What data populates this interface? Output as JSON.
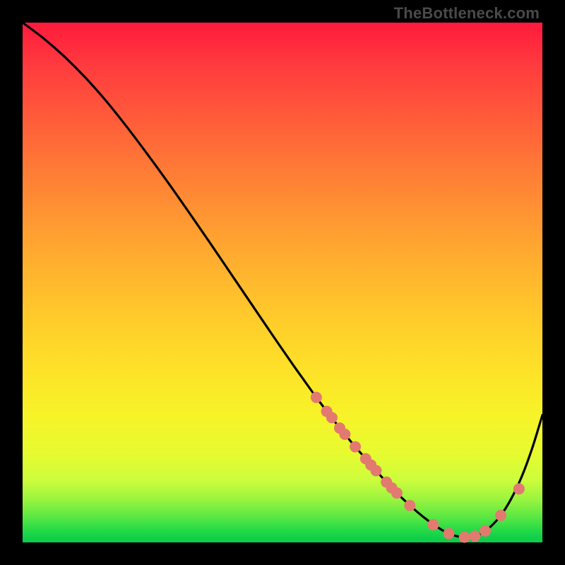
{
  "watermark": "TheBottleneck.com",
  "colors": {
    "background": "#000000",
    "gradient_top": "#ff1a3c",
    "gradient_bottom": "#0ccc4a",
    "curve": "#000000",
    "marker_fill": "#e27a70",
    "marker_stroke": "#c45a50"
  },
  "chart_data": {
    "type": "line",
    "title": "",
    "xlabel": "",
    "ylabel": "",
    "xlim": [
      0,
      100
    ],
    "ylim": [
      0,
      100
    ],
    "series": [
      {
        "name": "bottleneck-curve",
        "x": [
          0,
          4,
          8,
          12,
          16,
          20,
          24,
          28,
          32,
          36,
          40,
          44,
          48,
          52,
          54,
          56,
          58,
          60,
          62,
          64,
          66,
          68,
          70,
          72,
          74,
          76,
          78,
          80,
          82,
          84,
          86,
          88,
          90,
          92,
          94,
          96,
          98,
          100
        ],
        "y": [
          100,
          97,
          93.5,
          89.5,
          85,
          80,
          74.7,
          69.2,
          63.5,
          57.7,
          51.8,
          45.9,
          40,
          34.2,
          31.4,
          28.6,
          25.9,
          23.3,
          20.8,
          18.4,
          16.1,
          13.8,
          11.6,
          9.5,
          7.6,
          5.8,
          4.2,
          2.8,
          1.7,
          1.1,
          1.0,
          1.6,
          3.0,
          5.2,
          8.4,
          12.6,
          18.0,
          24.5
        ]
      }
    ],
    "markers": {
      "name": "highlight-range",
      "x": [
        56.5,
        58.5,
        59.5,
        61.0,
        62.0,
        64.0,
        66.0,
        67.0,
        68.0,
        70.0,
        71.0,
        72.0,
        74.5,
        79.0,
        82.0,
        85.0,
        87.0,
        89.0,
        92.0,
        95.5
      ],
      "y": [
        27.9,
        25.2,
        24.0,
        22.0,
        20.8,
        18.4,
        16.1,
        14.9,
        13.8,
        11.6,
        10.5,
        9.5,
        7.1,
        3.4,
        1.7,
        1.0,
        1.2,
        2.2,
        5.2,
        10.3
      ]
    }
  }
}
